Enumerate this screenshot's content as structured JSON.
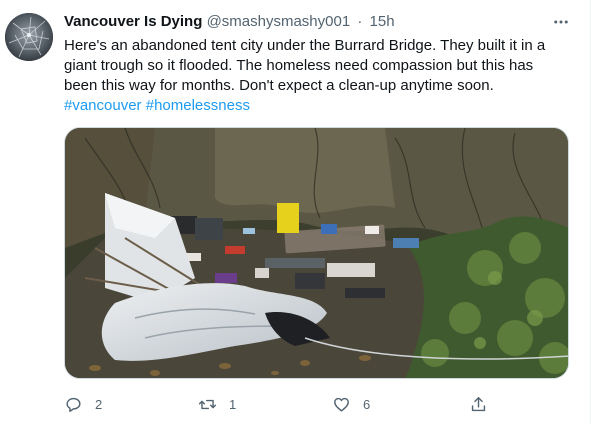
{
  "tweet": {
    "display_name": "Vancouver Is Dying",
    "handle": "@smashysmashy001",
    "separator": "·",
    "time": "15h",
    "text": "Here's an abandoned tent city under the Burrard Bridge. They built it in a giant trough so it flooded. The homeless need compassion but this has been this way for months. Don't expect a clean-up anytime soon.",
    "hashtags": [
      "#vancouver",
      "#homelessness"
    ],
    "more_icon": "ellipsis-icon",
    "media_description_icon": "photo"
  },
  "actions": {
    "reply": {
      "icon": "reply-icon",
      "count": "2"
    },
    "retweet": {
      "icon": "retweet-icon",
      "count": "1"
    },
    "like": {
      "icon": "heart-icon",
      "count": "6"
    },
    "share": {
      "icon": "share-icon"
    }
  },
  "colors": {
    "text": "#0f1419",
    "secondary": "#536471",
    "link": "#1d9bf0"
  }
}
